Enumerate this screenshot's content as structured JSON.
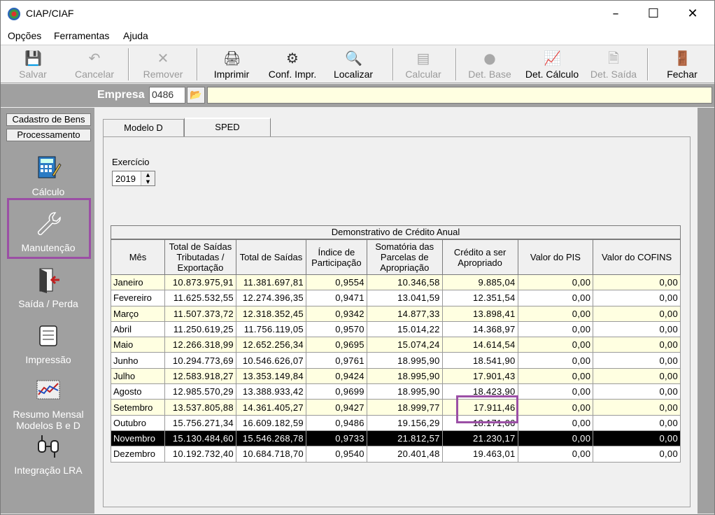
{
  "window": {
    "title": "CIAP/CIAF"
  },
  "menu": [
    "Opções",
    "Ferramentas",
    "Ajuda"
  ],
  "toolbar": {
    "salvar": "Salvar",
    "cancelar": "Cancelar",
    "remover": "Remover",
    "imprimir": "Imprimir",
    "conf_impr": "Conf. Impr.",
    "localizar": "Localizar",
    "calcular": "Calcular",
    "det_base": "Det. Base",
    "det_calculo": "Det. Cálculo",
    "det_saida": "Det. Saída",
    "fechar": "Fechar"
  },
  "empresa": {
    "label": "Empresa",
    "code": "0486"
  },
  "sidebar": {
    "tabs": [
      "Cadastro de Bens",
      "Processamento"
    ],
    "items": [
      {
        "label": "Cálculo"
      },
      {
        "label": "Manutenção"
      },
      {
        "label": "Saída / Perda"
      },
      {
        "label": "Impressão"
      },
      {
        "label": "Resumo Mensal Modelos B e D"
      },
      {
        "label": "Integração LRA"
      }
    ]
  },
  "tabs": [
    "Modelo D",
    "SPED"
  ],
  "exercicio": {
    "label": "Exercício",
    "value": "2019"
  },
  "grid": {
    "title": "Demonstrativo de Crédito Anual",
    "headers": [
      "Mês",
      "Total de Saídas Tributadas / Exportação",
      "Total de Saídas",
      "Índice de Participação",
      "Somatória das Parcelas de Apropriação",
      "Crédito a ser Apropriado",
      "Valor do PIS",
      "Valor do COFINS"
    ],
    "rows": [
      [
        "Janeiro",
        "10.873.975,91",
        "11.381.697,81",
        "0,9554",
        "10.346,58",
        "9.885,04",
        "0,00",
        "0,00"
      ],
      [
        "Fevereiro",
        "11.625.532,55",
        "12.274.396,35",
        "0,9471",
        "13.041,59",
        "12.351,54",
        "0,00",
        "0,00"
      ],
      [
        "Março",
        "11.507.373,72",
        "12.318.352,45",
        "0,9342",
        "14.877,33",
        "13.898,41",
        "0,00",
        "0,00"
      ],
      [
        "Abril",
        "11.250.619,25",
        "11.756.119,05",
        "0,9570",
        "15.014,22",
        "14.368,97",
        "0,00",
        "0,00"
      ],
      [
        "Maio",
        "12.266.318,99",
        "12.652.256,34",
        "0,9695",
        "15.074,24",
        "14.614,54",
        "0,00",
        "0,00"
      ],
      [
        "Junho",
        "10.294.773,69",
        "10.546.626,07",
        "0,9761",
        "18.995,90",
        "18.541,90",
        "0,00",
        "0,00"
      ],
      [
        "Julho",
        "12.583.918,27",
        "13.353.149,84",
        "0,9424",
        "18.995,90",
        "17.901,43",
        "0,00",
        "0,00"
      ],
      [
        "Agosto",
        "12.985.570,29",
        "13.388.933,42",
        "0,9699",
        "18.995,90",
        "18.423,90",
        "0,00",
        "0,00"
      ],
      [
        "Setembro",
        "13.537.805,88",
        "14.361.405,27",
        "0,9427",
        "18.999,77",
        "17.911,46",
        "0,00",
        "0,00"
      ],
      [
        "Outubro",
        "15.756.271,34",
        "16.609.182,59",
        "0,9486",
        "19.156,29",
        "18.171,66",
        "0,00",
        "0,00"
      ],
      [
        "Novembro",
        "15.130.484,60",
        "15.546.268,78",
        "0,9733",
        "21.812,57",
        "21.230,17",
        "0,00",
        "0,00"
      ],
      [
        "Dezembro",
        "10.192.732,40",
        "10.684.718,70",
        "0,9540",
        "20.401,48",
        "19.463,01",
        "0,00",
        "0,00"
      ]
    ],
    "selected_row": 10
  },
  "colors": {
    "highlight": "#9b4fa5",
    "row_alt": "#ffffe1",
    "sidebar_bg": "#a0a0a0"
  }
}
